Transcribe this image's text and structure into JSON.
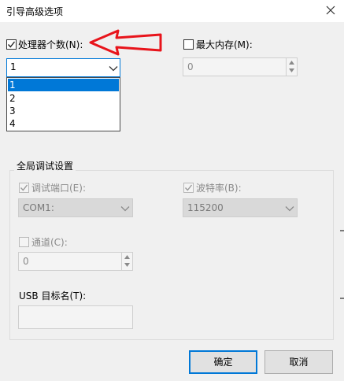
{
  "window": {
    "title": "引导高级选项"
  },
  "processor": {
    "label": "处理器个数(N):",
    "checked": true,
    "selected_value": "1",
    "options": [
      "1",
      "2",
      "3",
      "4"
    ]
  },
  "memory": {
    "label": "最大内存(M):",
    "checked": false,
    "value": "0"
  },
  "debug_group": {
    "title": "全局调试设置",
    "debug_port_label": "调试端口(E):",
    "debug_port_value": "COM1:",
    "baud_rate_label": "波特率(B):",
    "baud_rate_value": "115200",
    "channel_label": "通道(C):",
    "channel_value": "0",
    "usb_target_label": "USB 目标名(T):",
    "usb_target_value": ""
  },
  "buttons": {
    "ok": "确定",
    "cancel": "取消"
  },
  "colors": {
    "accent": "#0078d7",
    "annotation_arrow": "#e8141b"
  },
  "icons": [
    "close-icon",
    "chevron-down-icon",
    "spin-up-icon",
    "spin-down-icon",
    "checkmark-icon",
    "red-arrow-annotation"
  ]
}
